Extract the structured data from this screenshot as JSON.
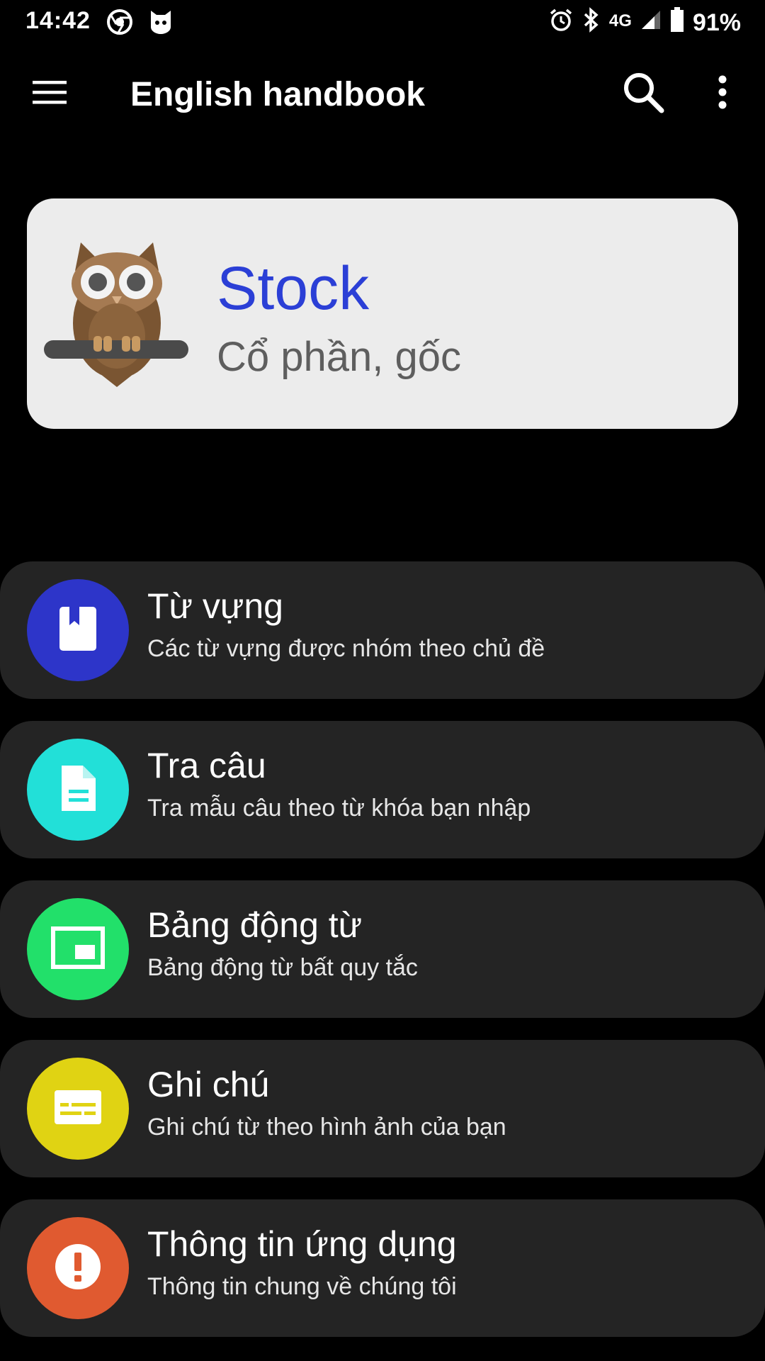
{
  "status_bar": {
    "time": "14:42",
    "network": "4G",
    "battery": "91%",
    "icons": [
      "chrome-icon",
      "app-notification-icon",
      "alarm-icon",
      "bluetooth-icon",
      "signal-icon",
      "battery-icon"
    ]
  },
  "app_bar": {
    "title": "English handbook",
    "icons": [
      "menu-icon",
      "search-icon",
      "more-vert-icon"
    ]
  },
  "word_card": {
    "word": "Stock",
    "meaning": "Cổ phần, gốc",
    "colors": {
      "word": "#2b3fd6",
      "meaning": "#5e5e5e",
      "background": "#ececec"
    }
  },
  "menu": {
    "items": [
      {
        "title": "Từ vựng",
        "subtitle": "Các từ vựng được nhóm theo chủ đề",
        "icon": "book-icon",
        "color": "#2d35c9"
      },
      {
        "title": "Tra câu",
        "subtitle": "Tra mẫu câu theo từ khóa bạn nhập",
        "icon": "document-icon",
        "color": "#22e0d8"
      },
      {
        "title": "Bảng động từ",
        "subtitle": "Bảng động từ bất quy tắc",
        "icon": "picture-in-picture-icon",
        "color": "#22e06a"
      },
      {
        "title": "Ghi chú",
        "subtitle": "Ghi chú từ theo hình ảnh của bạn",
        "icon": "subtitles-icon",
        "color": "#e0d313"
      },
      {
        "title": "Thông tin ứng dụng",
        "subtitle": "Thông tin chung về chúng tôi",
        "icon": "info-alert-icon",
        "color": "#e05a30"
      }
    ]
  }
}
